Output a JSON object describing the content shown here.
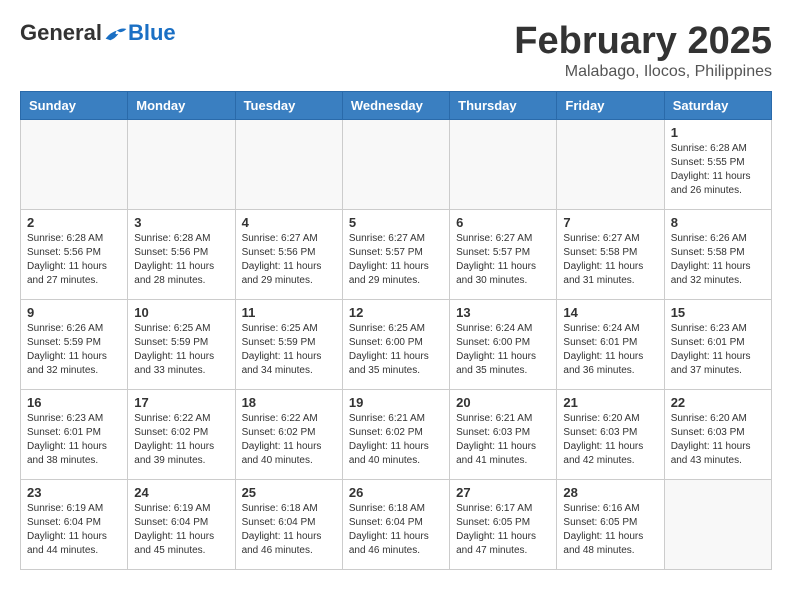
{
  "header": {
    "logo_general": "General",
    "logo_blue": "Blue",
    "month_year": "February 2025",
    "location": "Malabago, Ilocos, Philippines"
  },
  "weekdays": [
    "Sunday",
    "Monday",
    "Tuesday",
    "Wednesday",
    "Thursday",
    "Friday",
    "Saturday"
  ],
  "weeks": [
    [
      {
        "day": "",
        "info": ""
      },
      {
        "day": "",
        "info": ""
      },
      {
        "day": "",
        "info": ""
      },
      {
        "day": "",
        "info": ""
      },
      {
        "day": "",
        "info": ""
      },
      {
        "day": "",
        "info": ""
      },
      {
        "day": "1",
        "info": "Sunrise: 6:28 AM\nSunset: 5:55 PM\nDaylight: 11 hours and 26 minutes."
      }
    ],
    [
      {
        "day": "2",
        "info": "Sunrise: 6:28 AM\nSunset: 5:56 PM\nDaylight: 11 hours and 27 minutes."
      },
      {
        "day": "3",
        "info": "Sunrise: 6:28 AM\nSunset: 5:56 PM\nDaylight: 11 hours and 28 minutes."
      },
      {
        "day": "4",
        "info": "Sunrise: 6:27 AM\nSunset: 5:56 PM\nDaylight: 11 hours and 29 minutes."
      },
      {
        "day": "5",
        "info": "Sunrise: 6:27 AM\nSunset: 5:57 PM\nDaylight: 11 hours and 29 minutes."
      },
      {
        "day": "6",
        "info": "Sunrise: 6:27 AM\nSunset: 5:57 PM\nDaylight: 11 hours and 30 minutes."
      },
      {
        "day": "7",
        "info": "Sunrise: 6:27 AM\nSunset: 5:58 PM\nDaylight: 11 hours and 31 minutes."
      },
      {
        "day": "8",
        "info": "Sunrise: 6:26 AM\nSunset: 5:58 PM\nDaylight: 11 hours and 32 minutes."
      }
    ],
    [
      {
        "day": "9",
        "info": "Sunrise: 6:26 AM\nSunset: 5:59 PM\nDaylight: 11 hours and 32 minutes."
      },
      {
        "day": "10",
        "info": "Sunrise: 6:25 AM\nSunset: 5:59 PM\nDaylight: 11 hours and 33 minutes."
      },
      {
        "day": "11",
        "info": "Sunrise: 6:25 AM\nSunset: 5:59 PM\nDaylight: 11 hours and 34 minutes."
      },
      {
        "day": "12",
        "info": "Sunrise: 6:25 AM\nSunset: 6:00 PM\nDaylight: 11 hours and 35 minutes."
      },
      {
        "day": "13",
        "info": "Sunrise: 6:24 AM\nSunset: 6:00 PM\nDaylight: 11 hours and 35 minutes."
      },
      {
        "day": "14",
        "info": "Sunrise: 6:24 AM\nSunset: 6:01 PM\nDaylight: 11 hours and 36 minutes."
      },
      {
        "day": "15",
        "info": "Sunrise: 6:23 AM\nSunset: 6:01 PM\nDaylight: 11 hours and 37 minutes."
      }
    ],
    [
      {
        "day": "16",
        "info": "Sunrise: 6:23 AM\nSunset: 6:01 PM\nDaylight: 11 hours and 38 minutes."
      },
      {
        "day": "17",
        "info": "Sunrise: 6:22 AM\nSunset: 6:02 PM\nDaylight: 11 hours and 39 minutes."
      },
      {
        "day": "18",
        "info": "Sunrise: 6:22 AM\nSunset: 6:02 PM\nDaylight: 11 hours and 40 minutes."
      },
      {
        "day": "19",
        "info": "Sunrise: 6:21 AM\nSunset: 6:02 PM\nDaylight: 11 hours and 40 minutes."
      },
      {
        "day": "20",
        "info": "Sunrise: 6:21 AM\nSunset: 6:03 PM\nDaylight: 11 hours and 41 minutes."
      },
      {
        "day": "21",
        "info": "Sunrise: 6:20 AM\nSunset: 6:03 PM\nDaylight: 11 hours and 42 minutes."
      },
      {
        "day": "22",
        "info": "Sunrise: 6:20 AM\nSunset: 6:03 PM\nDaylight: 11 hours and 43 minutes."
      }
    ],
    [
      {
        "day": "23",
        "info": "Sunrise: 6:19 AM\nSunset: 6:04 PM\nDaylight: 11 hours and 44 minutes."
      },
      {
        "day": "24",
        "info": "Sunrise: 6:19 AM\nSunset: 6:04 PM\nDaylight: 11 hours and 45 minutes."
      },
      {
        "day": "25",
        "info": "Sunrise: 6:18 AM\nSunset: 6:04 PM\nDaylight: 11 hours and 46 minutes."
      },
      {
        "day": "26",
        "info": "Sunrise: 6:18 AM\nSunset: 6:04 PM\nDaylight: 11 hours and 46 minutes."
      },
      {
        "day": "27",
        "info": "Sunrise: 6:17 AM\nSunset: 6:05 PM\nDaylight: 11 hours and 47 minutes."
      },
      {
        "day": "28",
        "info": "Sunrise: 6:16 AM\nSunset: 6:05 PM\nDaylight: 11 hours and 48 minutes."
      },
      {
        "day": "",
        "info": ""
      }
    ]
  ]
}
